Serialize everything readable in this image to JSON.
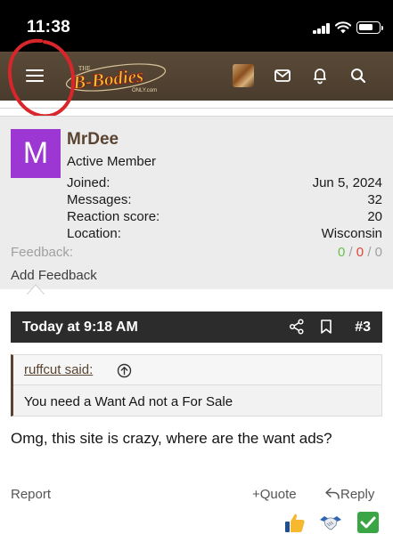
{
  "status_bar": {
    "time": "11:38"
  },
  "header": {
    "logo_text_top": "THE",
    "logo_text_main": "B-Bodies",
    "logo_text_sub": "ONLY.com",
    "icons": [
      "menu-icon",
      "avatar",
      "mail-icon",
      "bell-icon",
      "search-icon"
    ]
  },
  "member": {
    "avatar_letter": "M",
    "avatar_color": "#9c37d4",
    "name": "MrDee",
    "title": "Active Member",
    "stats": [
      {
        "label": "Joined:",
        "value": "Jun 5, 2024"
      },
      {
        "label": "Messages:",
        "value": "32"
      },
      {
        "label": "Reaction score:",
        "value": "20"
      },
      {
        "label": "Location:",
        "value": "Wisconsin"
      }
    ],
    "feedback_label": "Feedback:",
    "feedback_positive": "0",
    "feedback_neutral": "0",
    "feedback_negative": "0",
    "feedback_sep": "/",
    "add_feedback": "Add Feedback"
  },
  "post": {
    "date": "Today at 9:18 AM",
    "number": "#3",
    "quote_author": "ruffcut said:",
    "quote_text": "You need a Want Ad not a For Sale",
    "body": "Omg, this site is crazy, where are the want ads?"
  },
  "actions": {
    "report": "Report",
    "quote": "+Quote",
    "reply": "Reply"
  },
  "reactions": [
    "thumbs-up-icon",
    "handshake-icon",
    "checkmark-icon"
  ],
  "colors": {
    "brand_brown": "#5a4431",
    "header_bg": "#4a3c2d",
    "post_bar": "#2c2c2c",
    "feedback_positive": "#6cc04a",
    "feedback_negative": "#e0463a"
  }
}
